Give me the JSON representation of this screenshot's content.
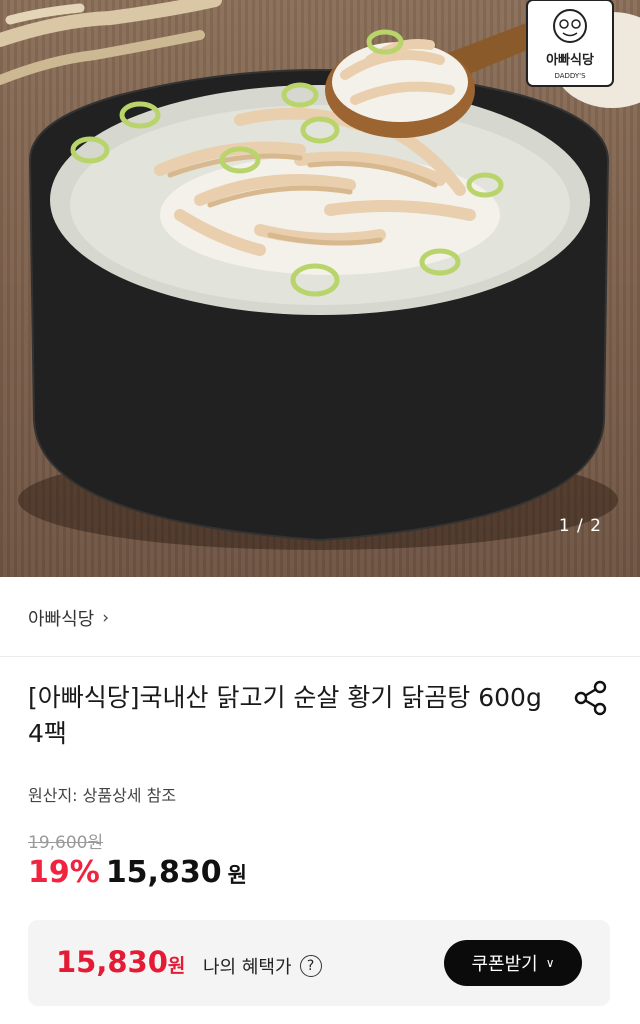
{
  "hero": {
    "image_counter": "1 / 2",
    "logo_text": "아빠식당",
    "logo_subtext": "DADDY'S"
  },
  "seller": {
    "name": "아빠식당",
    "chevron": "›"
  },
  "product": {
    "title": "[아빠식당]국내산 닭고기 순살 황기 닭곰탕 600g 4팩",
    "origin": "원산지: 상품상세 참조",
    "original_price": "19,600원",
    "discount": "19%",
    "price": "15,830",
    "currency": "원"
  },
  "benefit": {
    "price": "15,830",
    "currency": "원",
    "label": "나의 혜택가",
    "help_icon": "question-circle-icon",
    "coupon_button": "쿠폰받기",
    "coupon_chevron": "∨"
  },
  "icons": {
    "share": "share-icon"
  },
  "colors": {
    "accent_red": "#f0243f",
    "button_black": "#0b0b0b"
  }
}
